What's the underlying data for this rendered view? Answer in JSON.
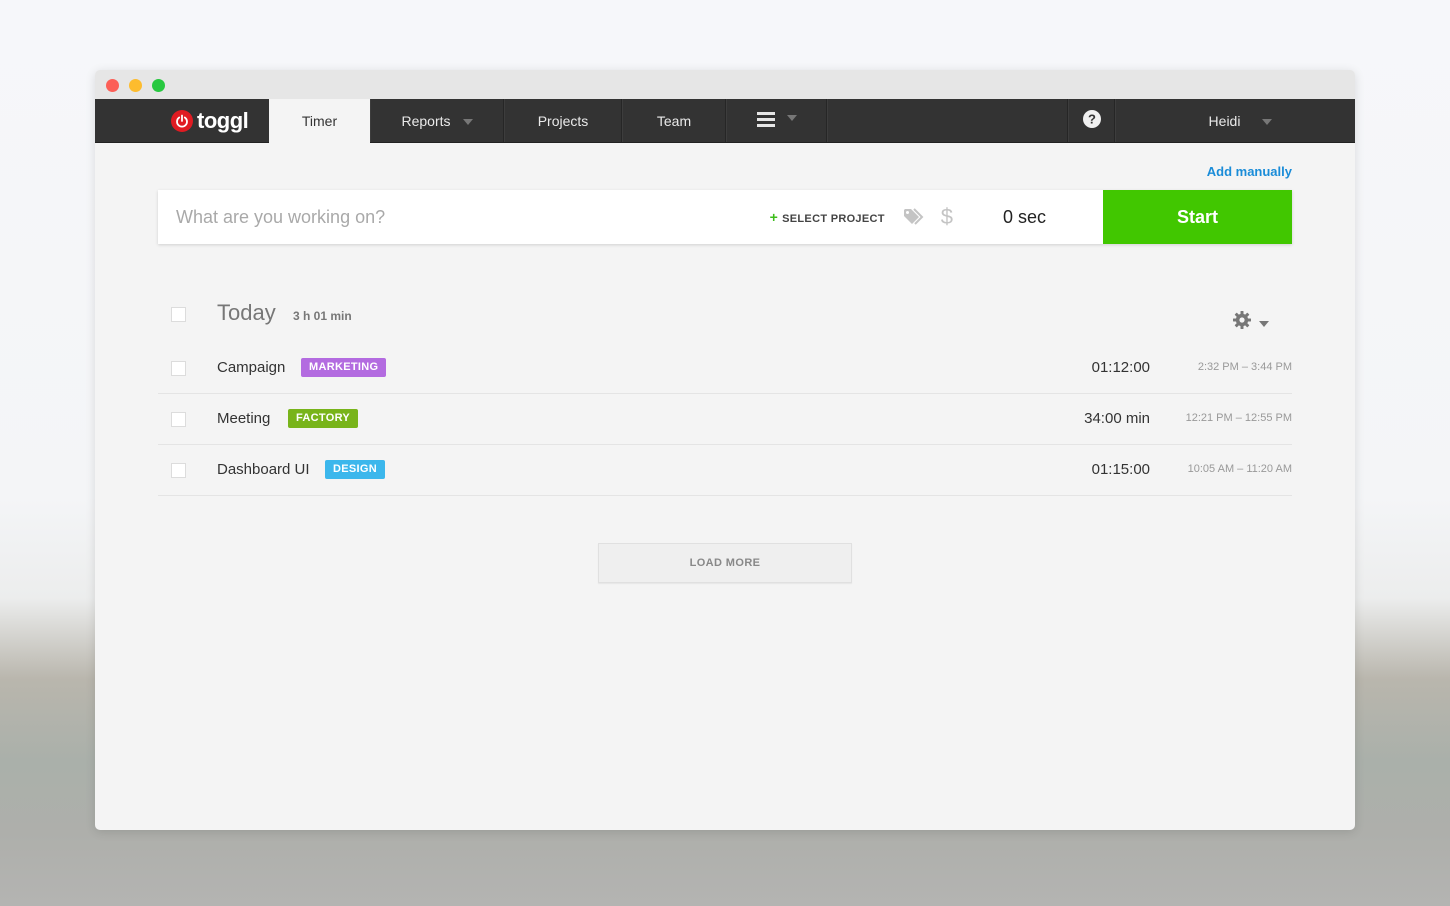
{
  "nav": {
    "logo_text": "toggl",
    "tabs": [
      {
        "label": "Timer",
        "active": true
      },
      {
        "label": "Reports",
        "has_dropdown": true
      },
      {
        "label": "Projects"
      },
      {
        "label": "Team"
      }
    ],
    "menu_icon": "hamburger-icon",
    "help_icon": "question-circle-icon",
    "user_name": "Heidi"
  },
  "timer": {
    "add_manually": "Add manually",
    "placeholder": "What are you working on?",
    "value": "",
    "select_project_plus": "+",
    "select_project_label": "SELECT PROJECT",
    "tag_icon": "tag-icon",
    "billable_icon": "$",
    "duration": "0 sec",
    "start_label": "Start",
    "start_color": "#41c700"
  },
  "day": {
    "title": "Today",
    "total": "3 h 01 min",
    "settings_icon": "gear-icon"
  },
  "entries": [
    {
      "description": "Campaign",
      "project": "MARKETING",
      "project_color": "#b36be0",
      "duration": "01:12:00",
      "range": "2:32 PM – 3:44 PM"
    },
    {
      "description": "Meeting",
      "project": "FACTORY",
      "project_color": "#78b41a",
      "duration": "34:00 min",
      "range": "12:21 PM – 12:55 PM"
    },
    {
      "description": "Dashboard UI",
      "project": "DESIGN",
      "project_color": "#3cb7ec",
      "duration": "01:15:00",
      "range": "10:05 AM – 11:20 AM"
    }
  ],
  "load_more": "LOAD MORE"
}
